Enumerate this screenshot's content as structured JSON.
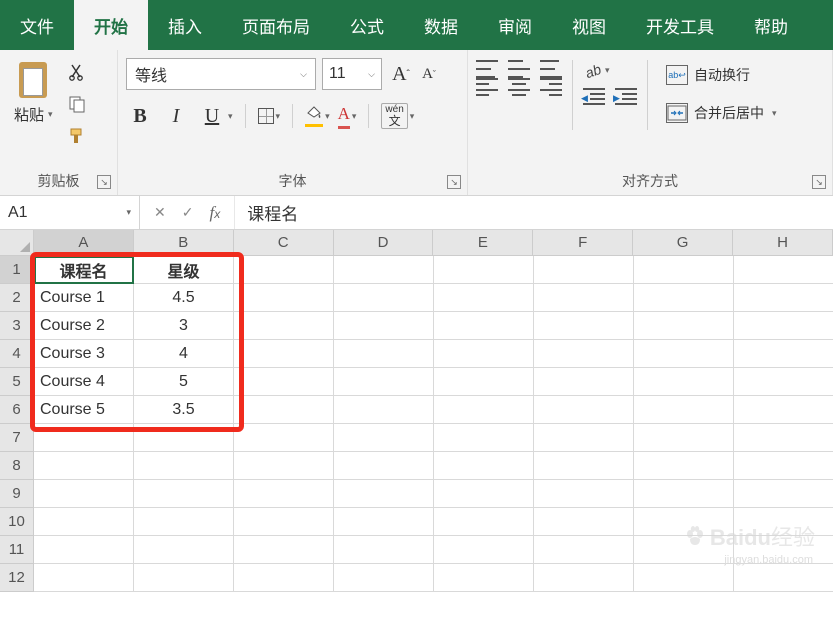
{
  "tabs": {
    "file": "文件",
    "home": "开始",
    "insert": "插入",
    "layout": "页面布局",
    "formulas": "公式",
    "data": "数据",
    "review": "审阅",
    "view": "视图",
    "dev": "开发工具",
    "help": "帮助"
  },
  "ribbon": {
    "clipboard": {
      "paste": "粘贴",
      "label": "剪贴板"
    },
    "font": {
      "name": "等线",
      "size": "11",
      "label": "字体",
      "bold": "B",
      "italic": "I",
      "underline": "U",
      "wen": "wén",
      "wenchar": "文"
    },
    "align": {
      "label": "对齐方式",
      "wrap": "自动换行",
      "merge": "合并后居中",
      "wraphint": "ab\nc"
    }
  },
  "namebox": "A1",
  "formula": "课程名",
  "columns": [
    "A",
    "B",
    "C",
    "D",
    "E",
    "F",
    "G",
    "H"
  ],
  "rows": [
    "1",
    "2",
    "3",
    "4",
    "5",
    "6",
    "7",
    "8",
    "9",
    "10",
    "11",
    "12"
  ],
  "table": {
    "headers": {
      "col1": "课程名",
      "col2": "星级"
    },
    "data": [
      {
        "name": "Course 1",
        "rating": "4.5"
      },
      {
        "name": "Course 2",
        "rating": "3"
      },
      {
        "name": "Course 3",
        "rating": "4"
      },
      {
        "name": "Course 4",
        "rating": "5"
      },
      {
        "name": "Course 5",
        "rating": "3.5"
      }
    ]
  },
  "watermark": {
    "brand": "Baidu",
    "sub": "经验",
    "url": "jingyan.baidu.com"
  }
}
